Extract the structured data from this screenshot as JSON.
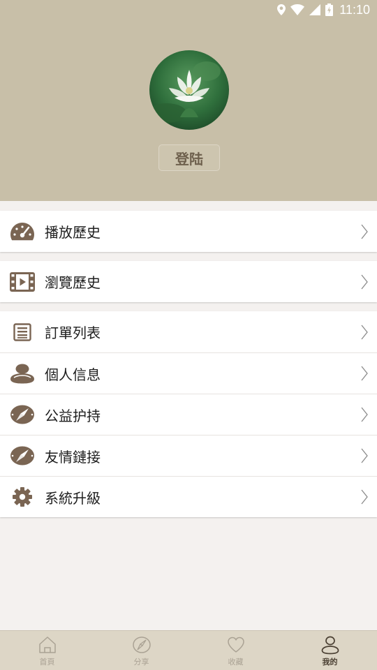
{
  "status_bar": {
    "time": "11:10"
  },
  "profile": {
    "login_label": "登陆"
  },
  "menu": {
    "group1": [
      {
        "label": "播放歷史",
        "icon": "gauge-icon"
      }
    ],
    "group2": [
      {
        "label": "瀏覽歷史",
        "icon": "film-icon"
      }
    ],
    "group3": [
      {
        "label": "訂單列表",
        "icon": "list-icon"
      },
      {
        "label": "個人信息",
        "icon": "user-icon"
      },
      {
        "label": "公益护持",
        "icon": "compass-icon"
      },
      {
        "label": "友情鏈接",
        "icon": "compass-icon"
      },
      {
        "label": "系統升級",
        "icon": "gear-icon"
      }
    ]
  },
  "tabbar": {
    "tabs": [
      {
        "label": "首頁",
        "icon": "home-icon",
        "active": false
      },
      {
        "label": "分享",
        "icon": "share-icon",
        "active": false
      },
      {
        "label": "收藏",
        "icon": "heart-icon",
        "active": false
      },
      {
        "label": "我的",
        "icon": "profile-icon",
        "active": true
      }
    ]
  },
  "colors": {
    "header_bg": "#c8bfa8",
    "icon_brown": "#7a6553",
    "page_bg": "#f4f1ef",
    "tabbar_bg": "#ddd6c6"
  }
}
